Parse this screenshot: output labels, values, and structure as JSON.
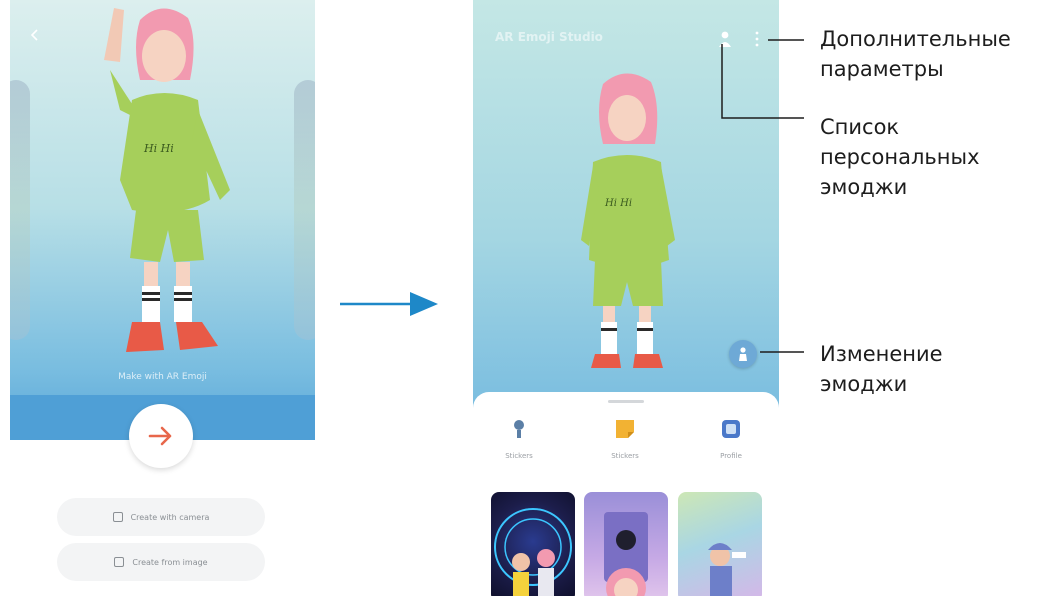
{
  "left_screen": {
    "avatar_name": "Make with AR Emoji",
    "create_with_camera": "Create with camera",
    "create_from_image": "Create from image"
  },
  "right_screen": {
    "title": "AR Emoji Studio",
    "categories": [
      {
        "label": "Stickers",
        "icon": "mic-avatar-icon",
        "color": "#5b7fa6"
      },
      {
        "label": "Stickers",
        "icon": "sticker-icon",
        "color": "#f2b233"
      },
      {
        "label": "Profile",
        "icon": "profile-card-icon",
        "color": "#4a78c9"
      }
    ]
  },
  "callouts": {
    "more_options": "Дополнительные параметры",
    "emoji_list": "Список персональных эмоджи",
    "edit_emoji": "Изменение эмоджи"
  },
  "colors": {
    "accent_arrow": "#1e88c8",
    "next_arrow": "#e8674b",
    "line": "#1d1d1d"
  }
}
